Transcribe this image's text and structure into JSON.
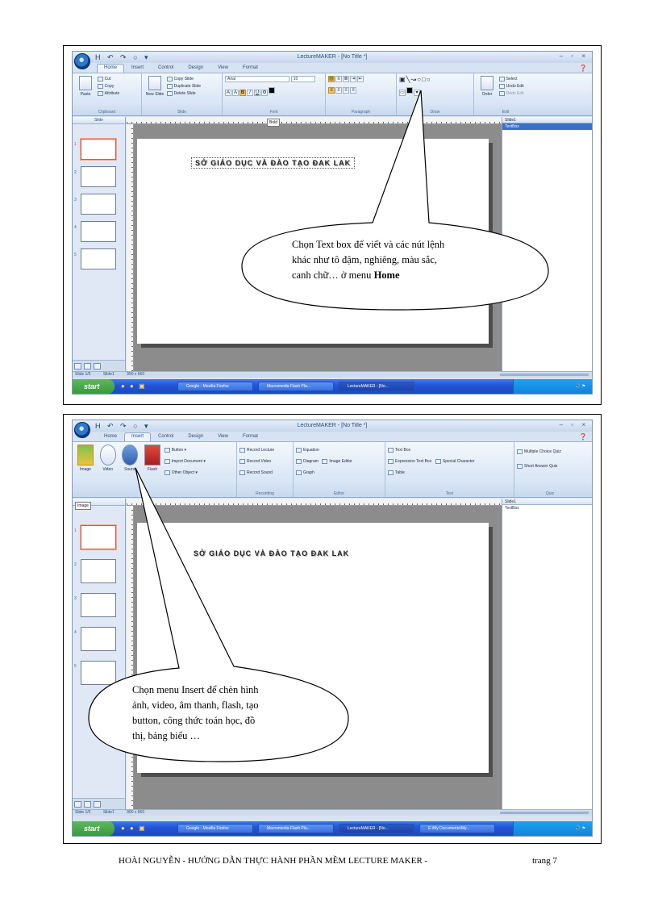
{
  "screenshot1": {
    "qat_icons": "H ↶ ↷ ○ ▾",
    "window_title": "LectureMAKER - [No Title *]",
    "window_buttons": "– ▫ ×",
    "tabs": [
      "Home",
      "Insert",
      "Control",
      "Design",
      "View",
      "Format"
    ],
    "active_tab": "Home",
    "ribbon": {
      "clipboard": {
        "paste": "Paste",
        "cut": "Cut",
        "copy": "Copy",
        "attribute": "Attribute",
        "label": "Clipboard"
      },
      "slide": {
        "new_slide": "New Slide",
        "copy_slide": "Copy Slide",
        "duplicate_slide": "Duplicate Slide",
        "delete_slide": "Delete Slide",
        "label": "Slide"
      },
      "font": {
        "font_name": "Arial",
        "font_size": "10",
        "label": "Font"
      },
      "paragraph": {
        "label": "Paragraph"
      },
      "draw": {
        "label": "Draw"
      },
      "edit": {
        "order": "Order",
        "select": "Select",
        "undo_edit": "Undo Edit",
        "redo_edit": "Redo Edit",
        "label": "Edit"
      }
    },
    "tooltip": "Bold",
    "slide_panel_title": "Slide",
    "slide_numbers": [
      "1",
      "2",
      "3",
      "4",
      "5"
    ],
    "slide_text": "SỞ GIÁO DỤC VÀ ĐÀO TẠO ĐAK LAK",
    "object_list": {
      "header": "Slide1",
      "item": "TextBox"
    },
    "status": {
      "left": "Slide 1/5",
      "middle": "Slide1",
      "size": "990 x 660"
    },
    "taskbar": {
      "start": "start",
      "buttons": [
        "Google - Mozilla Firefox",
        "Macromedia Flash Pla...",
        "LectureMAKER - [No..."
      ]
    },
    "callout": {
      "line1": "Chọn Text box để viết và các nút lệnh",
      "line2": "khác như tô đậm, nghiêng,  màu sắc,",
      "line3_prefix": "canh chữ… ở menu ",
      "line3_bold": "Home"
    }
  },
  "screenshot2": {
    "qat_icons": "H ↶ ↷ ○ ▾",
    "window_title": "LectureMAKER - [No Title *]",
    "window_buttons": "– ▫ ×",
    "tabs": [
      "Home",
      "Insert",
      "Control",
      "Design",
      "View",
      "Format"
    ],
    "active_tab": "Insert",
    "ribbon": {
      "media": {
        "image": "Image",
        "video": "Video",
        "sound": "Sound",
        "flash": "Flash"
      },
      "objects": {
        "button": "Button",
        "import_document": "Import Document",
        "other_object": "Other Object"
      },
      "recording": {
        "record_lecture": "Record Lecture",
        "record_video": "Record Video",
        "record_sound": "Record Sound",
        "label": "Recording"
      },
      "editor": {
        "equation": "Equation",
        "diagram": "Diagram",
        "image_editor": "Image Editor",
        "graph": "Graph",
        "label": "Editor"
      },
      "text": {
        "text_box": "Text Box",
        "expression_text_box": "Expression Text Box",
        "special_character": "Special Character",
        "table": "Table",
        "label": "Text"
      },
      "quiz": {
        "multiple_choice_quiz": "Multiple Choice Quiz",
        "short_answer_quiz": "Short Answer Quiz",
        "label": "Quiz"
      }
    },
    "tooltip": "Image",
    "slide_numbers": [
      "1",
      "2",
      "3",
      "4",
      "5"
    ],
    "slide_text": "SỞ GIÁO DỤC VÀ ĐÀO TẠO ĐAK LAK",
    "object_list": {
      "header": "Slide1",
      "item": "TextBox"
    },
    "status": {
      "left": "Slide 1/5",
      "middle": "Slide1",
      "size": "990 x 660"
    },
    "taskbar": {
      "start": "start",
      "buttons": [
        "Google - Mozilla Firefox",
        "Macromedia Flash Pla...",
        "LectureMAKER - [No...",
        "E:\\My Documents\\My..."
      ]
    },
    "callout": {
      "line1": "Chọn menu Insert để chèn hình",
      "line2": "ảnh, video, âm thanh, flash, tạo",
      "line3": "button, công thức toán học, đồ",
      "line4": "thị, bảng biểu …"
    }
  },
  "footer": {
    "title": "HOÀI NGUYỄN  -  HƯỚNG DẪN THỰC HÀNH PHẦN MỀM LECTURE  MAKER -",
    "page": "trang 7"
  }
}
